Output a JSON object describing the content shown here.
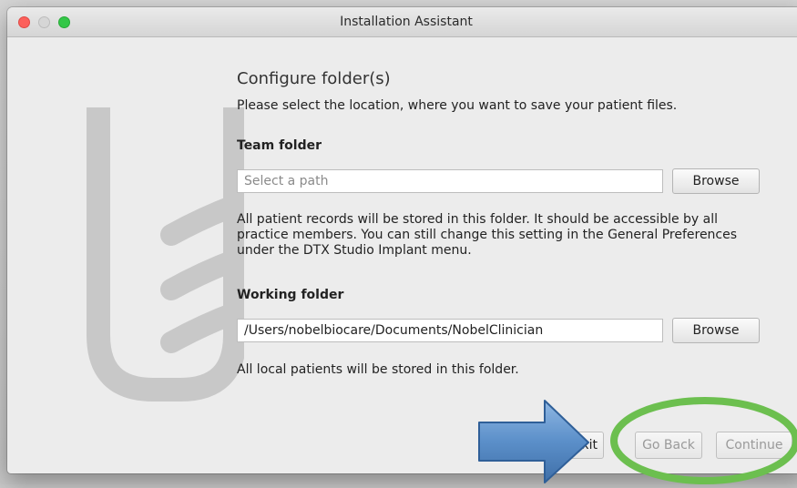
{
  "window": {
    "title": "Installation Assistant"
  },
  "page": {
    "heading": "Configure folder(s)",
    "intro": "Please select the location, where you want to save your patient files."
  },
  "team_folder": {
    "label": "Team folder",
    "value": "",
    "placeholder": "Select a path",
    "browse_label": "Browse",
    "description_lines": [
      "All patient records will be stored in this folder. It should be accessible by all",
      "practice members. You can still change this setting in the General Preferences",
      "under the DTX Studio Implant menu."
    ]
  },
  "working_folder": {
    "label": "Working folder",
    "value": "/Users/nobelbiocare/Documents/NobelClinician",
    "placeholder": "",
    "browse_label": "Browse",
    "description": "All local patients will be stored in this folder."
  },
  "footer": {
    "exit_label": "xit",
    "back_label": "Go Back",
    "continue_label": "Continue"
  },
  "colors": {
    "close_button": "#fc605b",
    "minimize_button": "#d6d6d6",
    "maximize_button": "#34c748",
    "annotation_arrow": "#5b8fc9",
    "annotation_ring": "#6cbf4f",
    "watermark_logo": "#c8c8c8"
  },
  "icons": {
    "close": "traffic-light-close",
    "minimize": "traffic-light-minimize",
    "maximize": "traffic-light-maximize",
    "logo": "dtx-studio-logo-watermark",
    "arrow": "right-arrow-annotation",
    "ring": "ellipse-highlight-annotation"
  }
}
